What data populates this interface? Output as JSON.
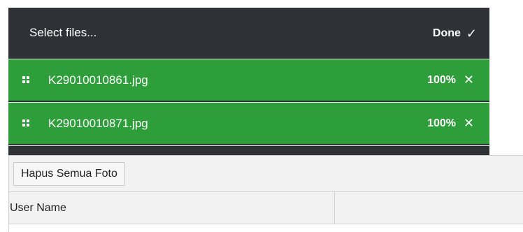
{
  "uploader": {
    "select_label": "Select files...",
    "done_label": "Done",
    "done_icon": "checkmark-icon",
    "files": [
      {
        "name": "K29010010861.jpg",
        "progress": "100%",
        "remove_icon": "close-icon"
      },
      {
        "name": "K29010010871.jpg",
        "progress": "100%",
        "remove_icon": "close-icon"
      }
    ],
    "colors": {
      "panel": "#2f3136",
      "success": "#2e9e3a"
    }
  },
  "grid": {
    "clear_button_label": "Hapus Semua Foto",
    "columns": [
      "User Name",
      ""
    ]
  }
}
